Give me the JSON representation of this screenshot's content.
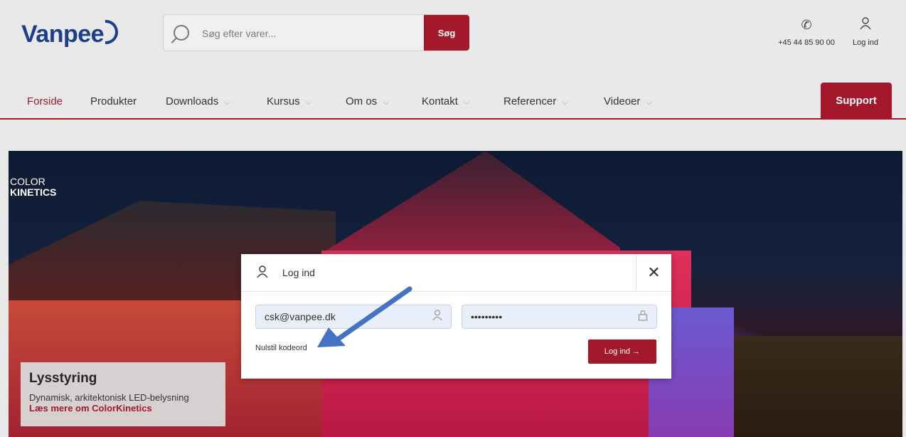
{
  "header": {
    "logo_text": "Vanpee",
    "search_placeholder": "Søg efter varer...",
    "search_button": "Søg",
    "phone": "+45 44 85 90 00",
    "login_label": "Log ind"
  },
  "nav": {
    "items": [
      {
        "label": "Forside",
        "active": true,
        "dropdown": false
      },
      {
        "label": "Produkter",
        "active": false,
        "dropdown": false
      },
      {
        "label": "Downloads",
        "active": false,
        "dropdown": true
      },
      {
        "label": "Kursus",
        "active": false,
        "dropdown": true
      },
      {
        "label": "Om os",
        "active": false,
        "dropdown": true
      },
      {
        "label": "Kontakt",
        "active": false,
        "dropdown": true
      },
      {
        "label": "Referencer",
        "active": false,
        "dropdown": true
      },
      {
        "label": "Videoer",
        "active": false,
        "dropdown": true
      }
    ],
    "support_button": "Support"
  },
  "hero": {
    "brand_line1": "COLOR",
    "brand_line2": "KINETICS",
    "promo_title": "Lysstyring",
    "promo_subtitle": "Dynamisk, arkitektonisk LED-belysning",
    "promo_link": "Læs mere om ColorKinetics"
  },
  "login_modal": {
    "title": "Log ind",
    "email_value": "csk@vanpee.dk",
    "password_value": "•••••••••",
    "reset_link": "Nulstil kodeord",
    "submit_label": "Log ind →"
  },
  "colors": {
    "brand_red": "#a3182a",
    "logo_blue": "#1c3f8c",
    "annotation_blue": "#4472c4"
  }
}
